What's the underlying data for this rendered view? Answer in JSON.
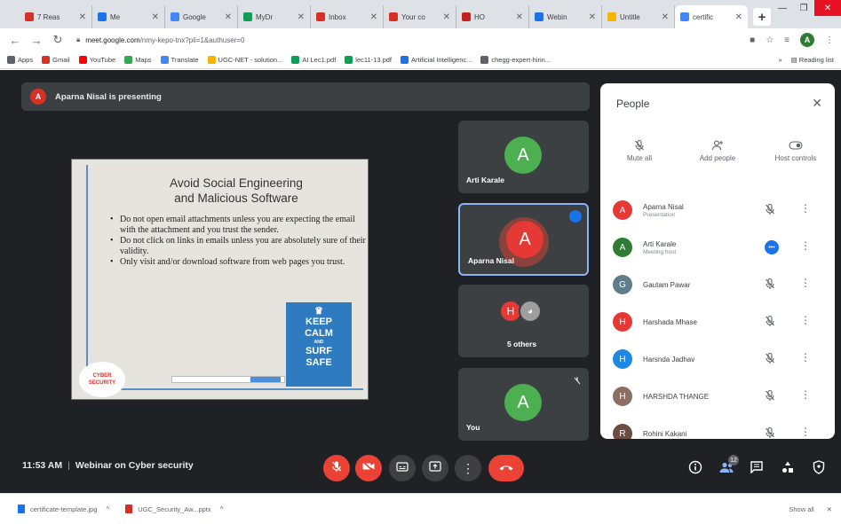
{
  "browser": {
    "tabs": [
      {
        "title": "7 Reas",
        "color": "#d93025"
      },
      {
        "title": "Me",
        "color": "#1a73e8"
      },
      {
        "title": "Google",
        "color": "#4285f4"
      },
      {
        "title": "MyDr",
        "color": "#0f9d58"
      },
      {
        "title": "Inbox",
        "color": "#d93025"
      },
      {
        "title": "Your co",
        "color": "#d93025"
      },
      {
        "title": "HO",
        "color": "#c5221f"
      },
      {
        "title": "Webin",
        "color": "#1a73e8"
      },
      {
        "title": "Untitle",
        "color": "#f4b400"
      },
      {
        "title": "certific",
        "color": "#4285f4"
      }
    ],
    "url_host": "meet.google.com",
    "url_path": "/nmy-kepo-tnx?pli=1&authuser=0",
    "bookmarks": [
      {
        "label": "Apps",
        "color": "#5f6368"
      },
      {
        "label": "Gmail",
        "color": "#d93025"
      },
      {
        "label": "YouTube",
        "color": "#ff0000"
      },
      {
        "label": "Maps",
        "color": "#34a853"
      },
      {
        "label": "Translate",
        "color": "#4285f4"
      },
      {
        "label": "UGC-NET - solution...",
        "color": "#f4b400"
      },
      {
        "label": "AI Lec1.pdf",
        "color": "#0f9d58"
      },
      {
        "label": "lec11-13.pdf",
        "color": "#0f9d58"
      },
      {
        "label": "Artificial Intelligenc...",
        "color": "#1a73e8"
      },
      {
        "label": "chegg-expert-hirin...",
        "color": "#5f6368"
      }
    ],
    "reading_list": "Reading list",
    "profile_initial": "A"
  },
  "meet": {
    "presenting_banner": "Aparna Nisal is presenting",
    "presenter_initial": "A",
    "slide": {
      "title_line1": "Avoid Social Engineering",
      "title_line2": "and Malicious Software",
      "bullets": [
        "Do not open email attachments unless you are expecting the email with the attachment and you trust the sender.",
        "Do not click on links in emails unless you are absolutely sure of their validity.",
        "Only visit and/or download software from web pages you trust."
      ],
      "keep_calm": [
        "KEEP",
        "CALM",
        "AND",
        "SURF",
        "SAFE"
      ],
      "badge": [
        "CYBER",
        "SECURITY"
      ]
    },
    "tiles": [
      {
        "name": "Arti Karale",
        "initial": "A",
        "color": "#4caf50"
      },
      {
        "name": "Aparna Nisal",
        "initial": "A",
        "color": "#e53935"
      },
      {
        "name": "5 others",
        "initial": "H",
        "color": "#e53935"
      },
      {
        "name": "You",
        "initial": "A",
        "color": "#4caf50"
      }
    ],
    "time": "11:53 AM",
    "meeting_title": "Webinar on Cyber security",
    "participant_count": "12"
  },
  "people_panel": {
    "title": "People",
    "actions": [
      {
        "label": "Mute all",
        "icon": "mic-off-icon"
      },
      {
        "label": "Add people",
        "icon": "add-person-icon"
      },
      {
        "label": "Host controls",
        "icon": "toggle-icon"
      }
    ],
    "participants": [
      {
        "name": "Aparna Nisal",
        "role": "Presentation",
        "initial": "A",
        "color": "#e53935"
      },
      {
        "name": "Arti Karale",
        "role": "Meeting host",
        "initial": "A",
        "color": "#2e7d32"
      },
      {
        "name": "Gautam Pawar",
        "role": "",
        "initial": "G",
        "color": "#607d8b"
      },
      {
        "name": "Harshada Mhase",
        "role": "",
        "initial": "H",
        "color": "#e53935"
      },
      {
        "name": "Harsnda Jadhav",
        "role": "",
        "initial": "H",
        "color": "#1e88e5"
      },
      {
        "name": "HARSHDA THANGE",
        "role": "",
        "initial": "H",
        "color": "#8d6e63"
      },
      {
        "name": "Rohini Kakani",
        "role": "",
        "initial": "R",
        "color": "#6d4c41"
      }
    ]
  },
  "downloads": [
    {
      "name": "certificate-template.jpg",
      "color": "#1a73e8"
    },
    {
      "name": "UGC_Security_Aw...pptx",
      "color": "#d93025"
    }
  ],
  "downloads_show_all": "Show all"
}
